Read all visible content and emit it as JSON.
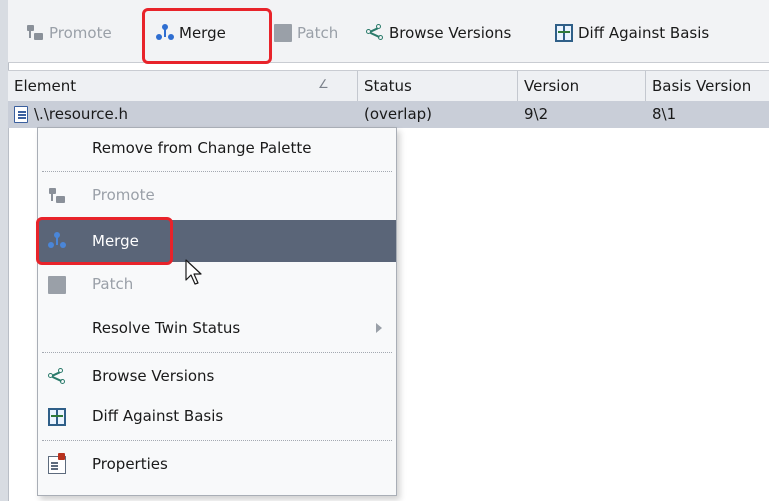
{
  "toolbar": {
    "promote_label": "Promote",
    "merge_label": "Merge",
    "patch_label": "Patch",
    "browse_versions_label": "Browse Versions",
    "diff_against_basis_label": "Diff Against Basis"
  },
  "table": {
    "columns": [
      "Element",
      "Status",
      "Version",
      "Basis Version"
    ],
    "rows": [
      {
        "element": "\\.\\resource.h",
        "status": "(overlap)",
        "version": "9\\2",
        "basis_version": "8\\1"
      }
    ]
  },
  "context_menu": {
    "items": [
      {
        "label": "Remove from Change Palette"
      },
      {
        "label": "Promote"
      },
      {
        "label": "Merge"
      },
      {
        "label": "Patch"
      },
      {
        "label": "Resolve Twin Status"
      },
      {
        "label": "Browse Versions"
      },
      {
        "label": "Diff Against Basis"
      },
      {
        "label": "Properties"
      }
    ]
  },
  "colors": {
    "highlight_outline": "#e8232a",
    "menu_active_bg": "#5a6578",
    "selected_row_bg": "#c9ced8"
  },
  "icons": [
    "promote-icon",
    "merge-icon",
    "patch-icon",
    "browse-versions-icon",
    "diff-against-basis-icon",
    "file-icon",
    "properties-icon",
    "submenu-arrow-icon",
    "mouse-cursor-icon"
  ]
}
